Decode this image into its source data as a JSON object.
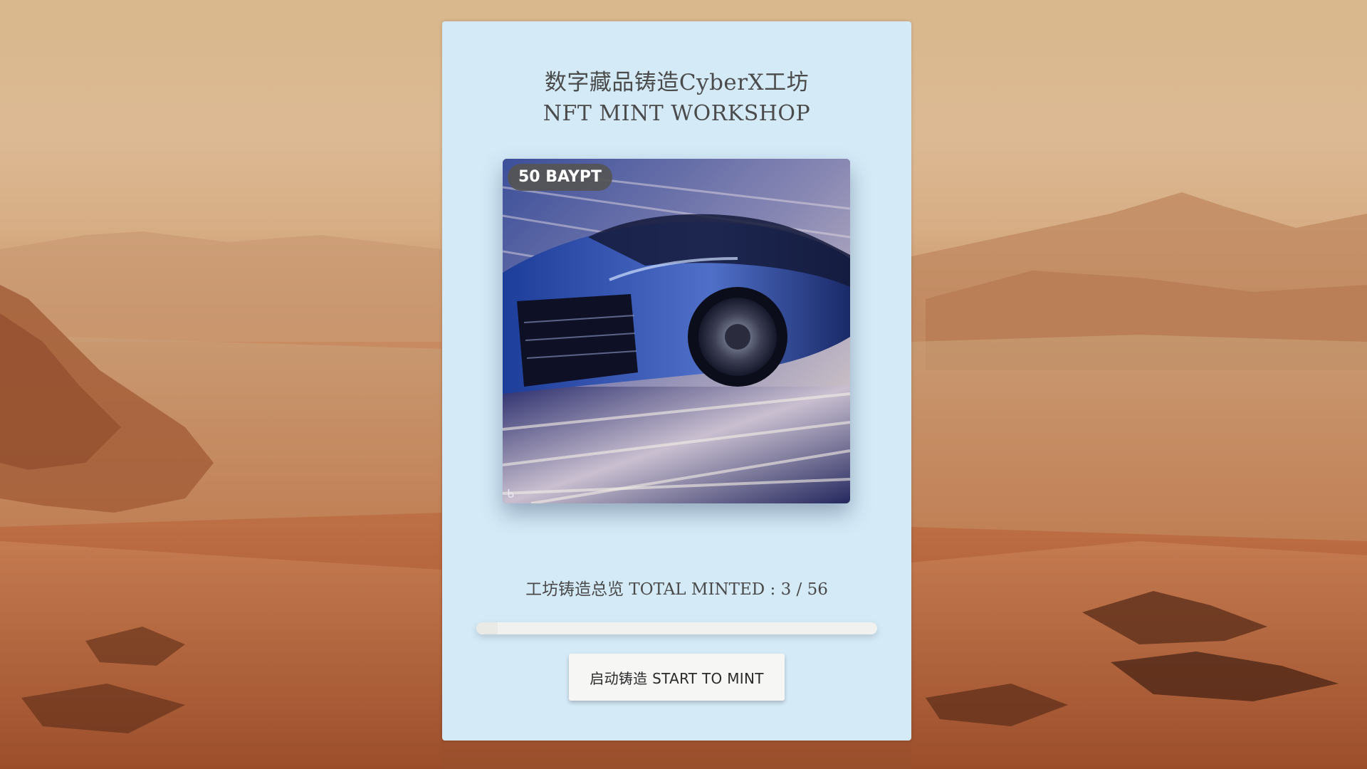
{
  "header": {
    "title_cn": "数字藏品铸造CyberX工坊",
    "title_en": "NFT MINT WORKSHOP"
  },
  "nft": {
    "price": "50 BAYPT",
    "image_icon": "sports-car-image",
    "corner_icon": "bing-logo-icon"
  },
  "stats": {
    "label": "工坊铸造总览 TOTAL MINTED : 3 / 56",
    "minted": 3,
    "total": 56,
    "progress_fraction": 0.054
  },
  "actions": {
    "mint_label": "启动铸造 START TO MINT"
  },
  "colors": {
    "panel": "#d4eaf7",
    "text": "#4b4b4b",
    "button": "#f6f6f5",
    "badge": "#555555"
  }
}
